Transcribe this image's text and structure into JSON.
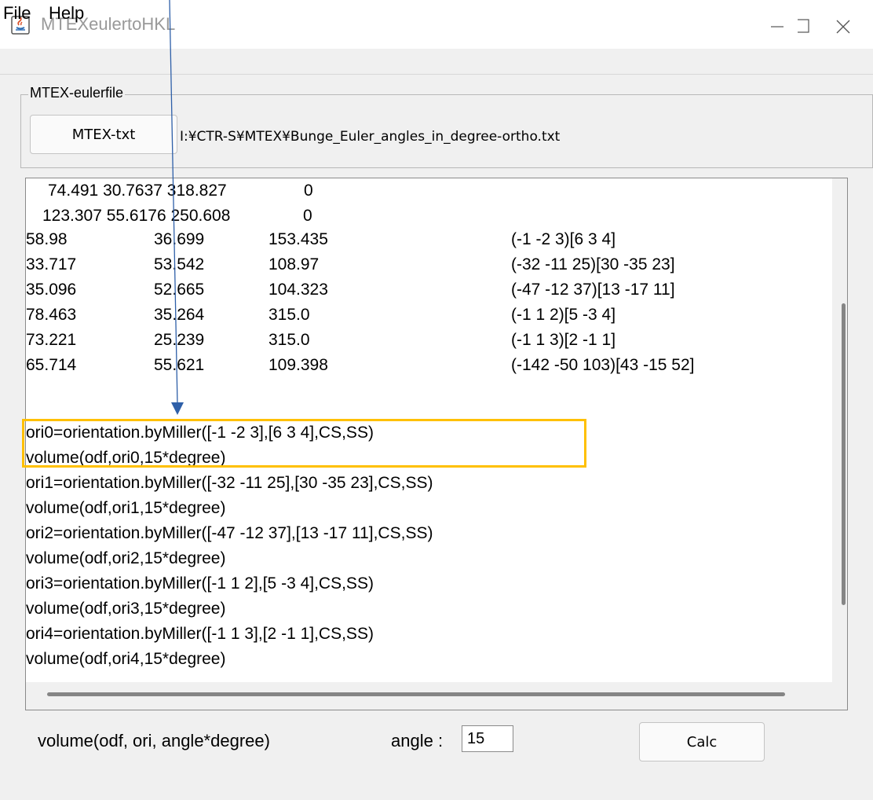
{
  "window": {
    "title": "MTEXeulertoHKL",
    "controls": {
      "minimize": "—",
      "maximize": "☐",
      "close": "✕"
    }
  },
  "menu": {
    "items": [
      {
        "label": "File"
      },
      {
        "label": "Help"
      }
    ]
  },
  "eulerfile": {
    "group_label": "MTEX-eulerfile",
    "button_label": "MTEX-txt",
    "path": "I:¥CTR-S¥MTEX¥Bunge_Euler_angles_in_degree-ortho.txt"
  },
  "output": {
    "header_rows": [
      {
        "angles": "74.491 30.7637 318.827",
        "value": "0"
      },
      {
        "angles": "123.307 55.6176 250.608",
        "value": "0"
      }
    ],
    "table_rows": [
      {
        "phi1": "58.98",
        "Phi": "36.699",
        "phi2": "153.435",
        "miller": "(-1 -2 3)[6 3 4]"
      },
      {
        "phi1": "33.717",
        "Phi": "53.542",
        "phi2": "108.97",
        "miller": "(-32 -11 25)[30 -35 23]"
      },
      {
        "phi1": "35.096",
        "Phi": "52.665",
        "phi2": "104.323",
        "miller": "(-47 -12 37)[13 -17 11]"
      },
      {
        "phi1": "78.463",
        "Phi": "35.264",
        "phi2": "315.0",
        "miller": "(-1 1 2)[5 -3 4]"
      },
      {
        "phi1": "73.221",
        "Phi": "25.239",
        "phi2": "315.0",
        "miller": "(-1 1 3)[2 -1 1]"
      },
      {
        "phi1": "65.714",
        "Phi": "55.621",
        "phi2": "109.398",
        "miller": "(-142 -50 103)[43 -15 52]"
      }
    ],
    "code_lines": [
      "ori0=orientation.byMiller([-1 -2 3],[6 3 4],CS,SS)",
      "volume(odf,ori0,15*degree)",
      "ori1=orientation.byMiller([-32 -11 25],[30 -35 23],CS,SS)",
      "volume(odf,ori1,15*degree)",
      "ori2=orientation.byMiller([-47 -12 37],[13 -17 11],CS,SS)",
      "volume(odf,ori2,15*degree)",
      "ori3=orientation.byMiller([-1 1 2],[5 -3 4],CS,SS)",
      "volume(odf,ori3,15*degree)",
      "ori4=orientation.byMiller([-1 1 3],[2 -1 1],CS,SS)",
      "volume(odf,ori4,15*degree)"
    ]
  },
  "controls": {
    "formula_label": "volume(odf, ori, angle*degree)",
    "angle_label": "angle :",
    "angle_value": "15",
    "calc_label": "Calc"
  },
  "colors": {
    "highlight": "#ffc000",
    "arrow": "#2e5fa8"
  }
}
